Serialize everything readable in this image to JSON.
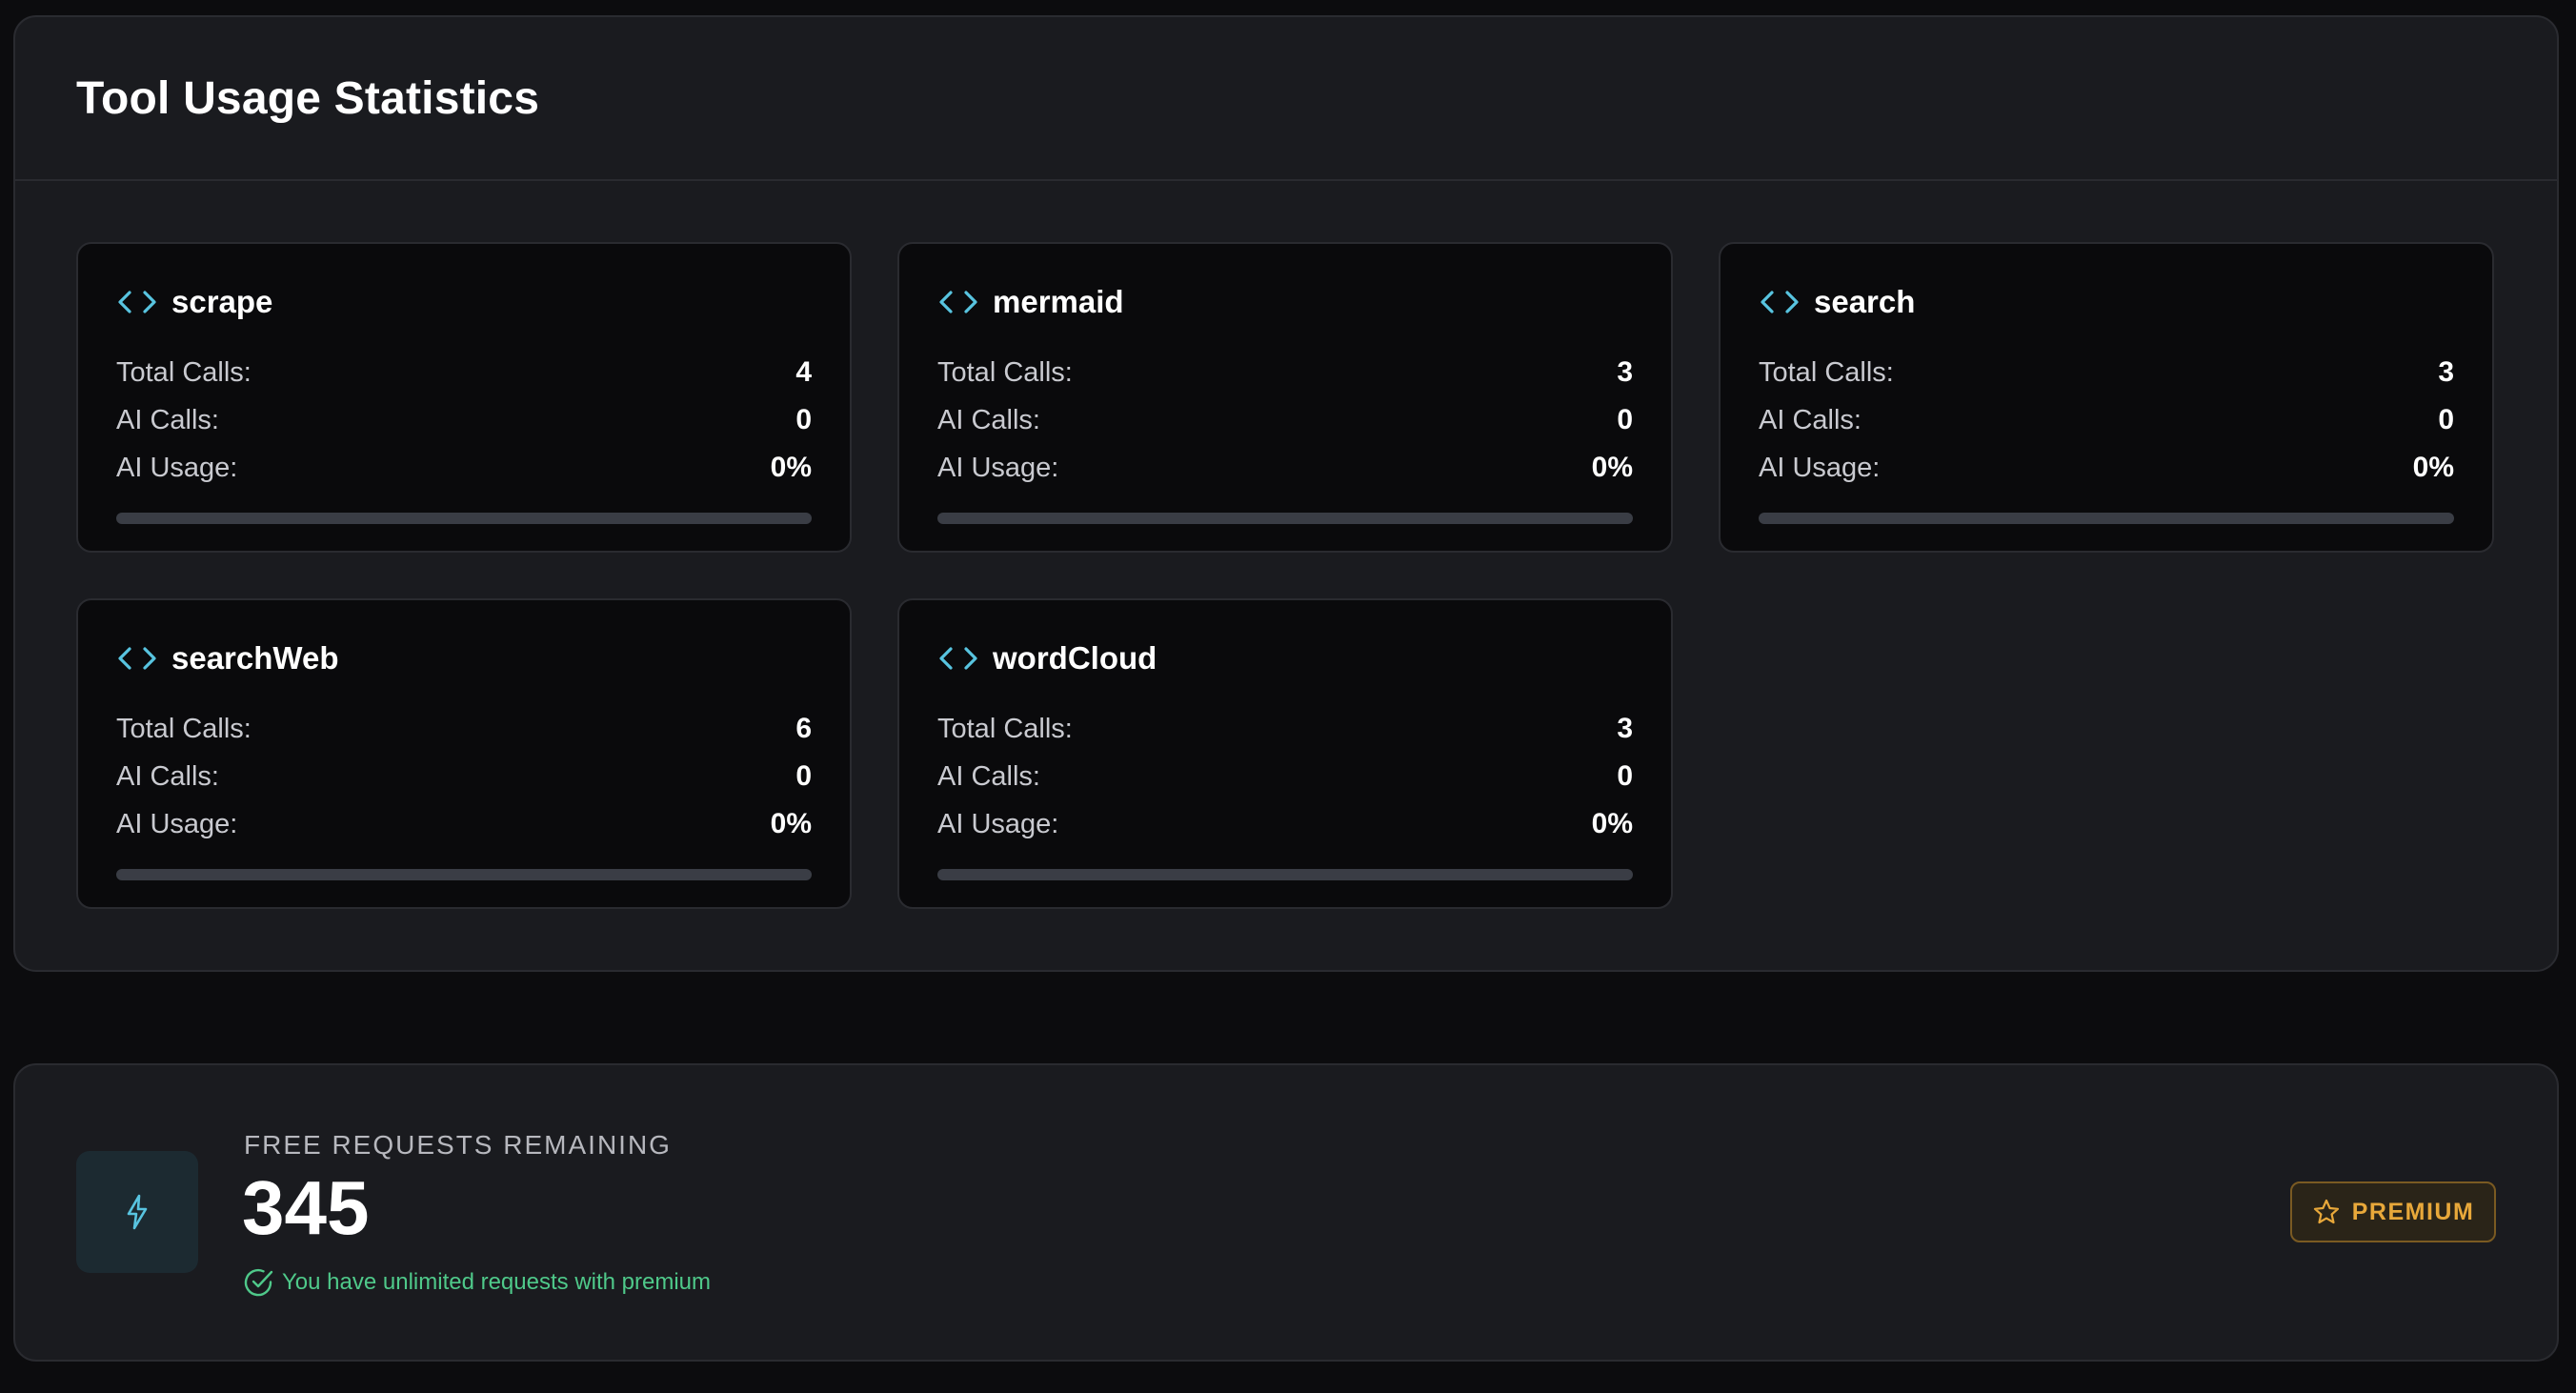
{
  "stats": {
    "title": "Tool Usage Statistics",
    "labels": {
      "total_calls": "Total Calls:",
      "ai_calls": "AI Calls:",
      "ai_usage": "AI Usage:"
    },
    "tools": [
      {
        "name": "scrape",
        "total_calls": "4",
        "ai_calls": "0",
        "ai_usage": "0%",
        "ai_usage_fraction": 0
      },
      {
        "name": "mermaid",
        "total_calls": "3",
        "ai_calls": "0",
        "ai_usage": "0%",
        "ai_usage_fraction": 0
      },
      {
        "name": "search",
        "total_calls": "3",
        "ai_calls": "0",
        "ai_usage": "0%",
        "ai_usage_fraction": 0
      },
      {
        "name": "searchWeb",
        "total_calls": "6",
        "ai_calls": "0",
        "ai_usage": "0%",
        "ai_usage_fraction": 0
      },
      {
        "name": "wordCloud",
        "total_calls": "3",
        "ai_calls": "0",
        "ai_usage": "0%",
        "ai_usage_fraction": 0
      }
    ],
    "icon": "code-icon"
  },
  "requests": {
    "label": "FREE REQUESTS REMAINING",
    "count": "345",
    "note": "You have unlimited requests with premium",
    "icon": "lightning-icon",
    "note_icon": "check-circle-icon",
    "premium_label": "PREMIUM",
    "premium_icon": "star-icon"
  },
  "colors": {
    "accent": "#58c4e0",
    "success": "#4fc98a",
    "premium": "#e8a83a",
    "background": "#0c0c0e",
    "panel": "#1a1b1f"
  }
}
